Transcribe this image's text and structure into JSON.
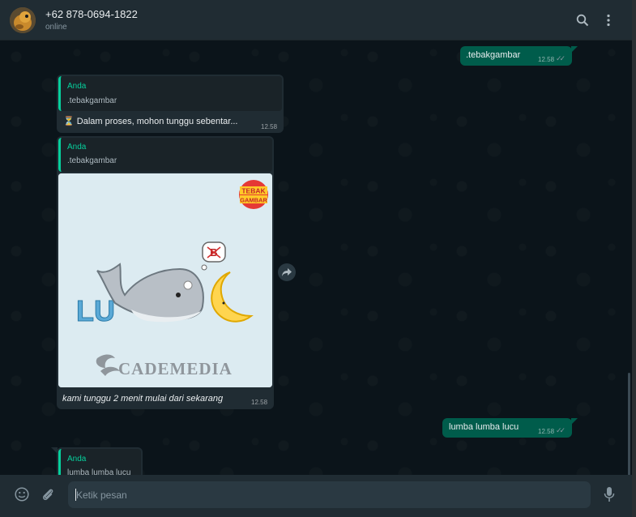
{
  "header": {
    "contact_name": "+62 878-0694-1822",
    "status": "online",
    "icons": [
      "search-icon",
      "menu-kebab-icon"
    ]
  },
  "messages": [
    {
      "type": "outgoing",
      "text": ".tebakgambar",
      "time": "12.58",
      "ticks": "✓✓"
    },
    {
      "type": "incoming",
      "quote_author": "Anda",
      "quote_text": ".tebakgambar",
      "text": "⏳ Dalam proses, mohon tunggu sebentar...",
      "time": "12.58"
    },
    {
      "type": "incoming-image",
      "quote_author": "Anda",
      "quote_text": ".tebakgambar",
      "image": {
        "badge_line1": "TEBAK",
        "badge_line2": "GAMBAR",
        "letters": "LU",
        "watermark": "CADEMEDIA"
      },
      "caption": "kami tunggu 2 menit mulai dari sekarang",
      "time": "12.58"
    },
    {
      "type": "outgoing",
      "text": "lumba lumba lucu",
      "time": "12.58",
      "ticks": "✓✓"
    },
    {
      "type": "incoming",
      "quote_author": "Anda",
      "quote_text": "lumba lumba lucu"
    }
  ],
  "composer": {
    "placeholder": "Ketik pesan",
    "icons": [
      "emoji-icon",
      "attach-icon",
      "microphone-icon"
    ]
  },
  "colors": {
    "header_bg": "#202c33",
    "chat_bg": "#0b141a",
    "outgoing_bubble": "#005c4b",
    "incoming_bubble": "#202c33",
    "quote_accent": "#06cf9c"
  }
}
